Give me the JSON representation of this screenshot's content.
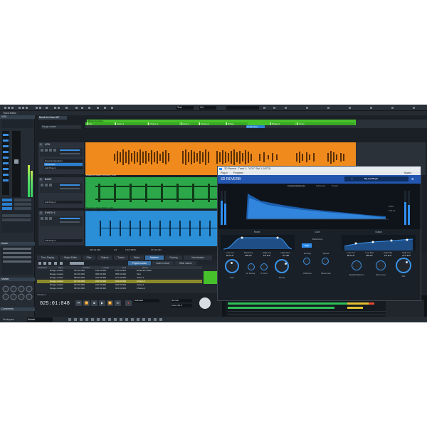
{
  "toolbar": {
    "project_field": "Text",
    "tempo_field": "1/4"
  },
  "inspector": {
    "title": "Track Editor",
    "track_label": "VOX",
    "sections": [
      "Audio",
      "Master"
    ],
    "bottom_label": "Comments",
    "workspace_label": "Workspace",
    "workspace_value": "Default"
  },
  "arrange": {
    "project_tab": "Break the Dawn.MP",
    "range_label": "Range marker",
    "markers": [
      {
        "label": "Intro"
      },
      {
        "label": "Verse 1"
      },
      {
        "label": "Chorus 1"
      },
      {
        "label": "Verse 2"
      },
      {
        "label": "Chorus 2"
      },
      {
        "label": "Bridge"
      },
      {
        "label": "Bridge 2"
      },
      {
        "label": "Outro"
      }
    ],
    "top_range_label": "Break the Dawn",
    "guitar_marker": "Guitar Solo",
    "tracks": [
      {
        "num": "1",
        "name": "VOX",
        "slot1": "Dynamic Equalizer",
        "slot2": "3D Reverb",
        "slot3": "Add Plug-in",
        "object_title": "Break the Dawn VOCALS_0.48",
        "color": "#f08a1c"
      },
      {
        "num": "2",
        "name": "BASS",
        "slot1": "",
        "slot2": "",
        "slot3": "Add Plug-in",
        "object_title": "Break the Dawn BASS_0.48",
        "color": "#2ca84a"
      },
      {
        "num": "3",
        "name": "SYNTH 1",
        "slot1": "",
        "slot2": "",
        "slot3": "Add Plug-in",
        "object_title": "Break the Dawn SYNTH 1_0.48",
        "color": "#2a8fd6"
      }
    ],
    "status_values": [
      "025:01:048",
      "4/4",
      "115.0 BPM",
      "074:01:001"
    ]
  },
  "lower": {
    "tabs": [
      "Time Display",
      "Object Editor",
      "Files",
      "Objects",
      "Tracks",
      "Takes",
      "Markers",
      "Routing",
      "Visualization"
    ],
    "active_tab": "Markers",
    "subtabs": [
      "Project marker",
      "Audio marker",
      "Slide marker"
    ],
    "columns": [
      "Selection",
      "Type",
      "Position",
      "Length",
      "End",
      "Name"
    ],
    "rows": [
      [
        "",
        "Range marker",
        "001:01:000",
        "165:01:000",
        "165:01:000",
        "Break the Dawn"
      ],
      [
        "",
        "Range marker",
        "001:01:000",
        "005:01:000",
        "005:01:000",
        "Intro"
      ],
      [
        "",
        "Range marker",
        "005:01:000",
        "012:01:000",
        "017:01:000",
        "Verse 1"
      ],
      [
        "",
        "Range marker",
        "017:01:000",
        "016:01:000",
        "033:01:000",
        "Chorus 1"
      ],
      [
        "",
        "Range marker",
        "033:01:000",
        "012:01:000",
        "045:01:000",
        "Verse 2"
      ],
      [
        "",
        "Range marker",
        "045:01:000",
        "016:01:000",
        "061:01:000",
        "Chorus 2"
      ]
    ],
    "transport_label": "Transport",
    "timecode": "025:01:048",
    "tempo_field": "Normal",
    "tempo_value": "Auto 120.0",
    "standard_label": "Standard"
  },
  "plugin": {
    "window_title": "3D Reverb - Track 1: \"VOX\" Slot 1 (VST3)",
    "menu_items": [
      "Plug-in",
      "Programs"
    ],
    "menu_right": "Bypass",
    "name": "3D REVERB",
    "preset": "Big Hall Bright",
    "preset_index": "1",
    "tabs": [
      "Impulse Response",
      "Advanced",
      "Output"
    ],
    "sections": [
      "Room",
      "Color",
      "Output"
    ],
    "room_params": [
      {
        "label": "Low Cut",
        "value": "20.0 Hz"
      },
      {
        "label": "Mid Freq",
        "value": "500 Hz"
      },
      {
        "label": "High Cut",
        "value": "6.6 kHz"
      },
      {
        "label": "High Gain",
        "value": "-4.0 dB"
      }
    ],
    "reflections_label": "Reflections",
    "reflection_mode": "High",
    "color_params": [
      "Density",
      "Speed",
      "Diffusion",
      "Movement"
    ],
    "output_params": [
      {
        "label": "Low Cut",
        "value": "80.0 Hz"
      },
      {
        "label": "Low Mid",
        "value": "250 Hz"
      },
      {
        "label": "High Mid",
        "value": "2.5 kHz"
      },
      {
        "label": "High Cut",
        "value": "12.0 kHz"
      }
    ],
    "knobs_left": [
      "Size",
      "LF Decay",
      "X-Over",
      "Decay"
    ],
    "knobs_right": [
      "Spatial Balance",
      "Wet Level",
      "Mix"
    ],
    "range_labels": [
      "1000",
      "100 Hz"
    ]
  },
  "colors": {
    "accent": "#2f8ff0",
    "vox": "#f08a1c",
    "bass": "#2ca84a",
    "synth": "#2a8fd6",
    "marker_green": "#46c12c"
  }
}
